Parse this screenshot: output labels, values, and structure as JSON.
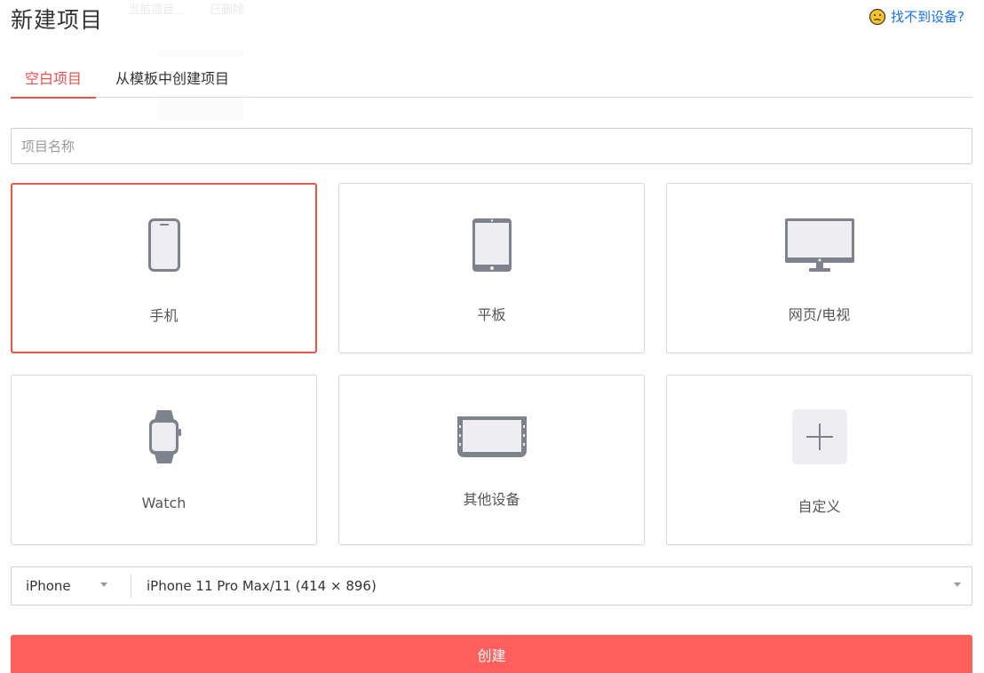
{
  "page": {
    "title": "新建项目",
    "ghost_tabs": [
      "当前项目",
      "已删除"
    ],
    "help_link": "找不到设备?"
  },
  "tabs": [
    {
      "label": "空白项目",
      "active": true
    },
    {
      "label": "从模板中创建项目",
      "active": false
    }
  ],
  "project_name": {
    "value": "",
    "placeholder": "项目名称"
  },
  "devices": [
    {
      "label": "手机",
      "icon": "phone-icon",
      "selected": true
    },
    {
      "label": "平板",
      "icon": "tablet-icon",
      "selected": false
    },
    {
      "label": "网页/电视",
      "icon": "monitor-icon",
      "selected": false
    },
    {
      "label": "Watch",
      "icon": "watch-icon",
      "selected": false
    },
    {
      "label": "其他设备",
      "icon": "car-display-icon",
      "selected": false
    },
    {
      "label": "自定义",
      "icon": "plus-icon",
      "selected": false
    }
  ],
  "device_selector": {
    "brand": "iPhone",
    "model": "iPhone 11 Pro Max/11 (414 × 896)"
  },
  "create_button": "创建",
  "colors": {
    "accent": "#f0504f",
    "button": "#ff605c",
    "link": "#1a73e8",
    "icon": "#7d828c"
  }
}
